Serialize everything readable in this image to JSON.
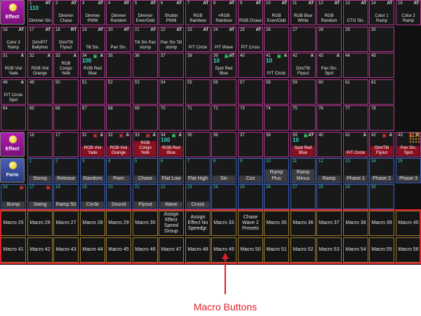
{
  "rows": [
    {
      "head": {
        "kind": "effect",
        "label": "Effect"
      },
      "cells": [
        {
          "num": "1",
          "tag": "AT",
          "big": "110",
          "label": "Dimmer Sin",
          "style": "blue"
        },
        {
          "num": "2",
          "tag": "AT",
          "label": "Dimmer Chase"
        },
        {
          "num": "3",
          "tag": "AT",
          "label": "Dimmer PWM"
        },
        {
          "num": "4",
          "tag": "AT",
          "label": "Dimmer Random"
        },
        {
          "num": "5",
          "tag": "AT",
          "label": "Dimmer Even/Odd"
        },
        {
          "num": "6",
          "tag": "AT",
          "label": "Shutter PWM"
        },
        {
          "num": "7",
          "tag": "AT",
          "label": "RGB Rainbow"
        },
        {
          "num": "8",
          "tag": "AT",
          "label": "+RGB Rainbow"
        },
        {
          "num": "9",
          "tag": "AT",
          "label": "RGB Chase"
        },
        {
          "num": "10",
          "tag": "AT",
          "label": "RGB Even/Odd"
        },
        {
          "num": "11",
          "tag": "AT",
          "label": "RGB Blue White"
        },
        {
          "num": "12",
          "tag": "AT",
          "label": "RGB Random"
        },
        {
          "num": "13",
          "tag": "AT",
          "label": "CTO Sin."
        },
        {
          "num": "14",
          "tag": "AT",
          "label": "Color 1 Ramp"
        },
        {
          "num": "15",
          "tag": "AT",
          "label": "Color 2 Ramp"
        }
      ]
    },
    {
      "head": null,
      "cells": [
        {
          "num": "16",
          "tag": "AT",
          "label": "Color 3 Ramp"
        },
        {
          "num": "17",
          "tag": "AT",
          "label": "Dim/P/T Ballyhoo"
        },
        {
          "num": "18",
          "tag": "RT",
          "label": "Dim/Tilt Flyout"
        },
        {
          "num": "19",
          "tag": "AT",
          "label": "Tilt Sin."
        },
        {
          "num": "20",
          "tag": "AT",
          "label": "Pan Sin."
        },
        {
          "num": "21",
          "tag": "AT",
          "label": "Tilt Sin Pan stomp"
        },
        {
          "num": "22",
          "tag": "AT",
          "label": "Pan Sin Tilt stomp"
        },
        {
          "num": "23",
          "tag": "AT",
          "label": "P/T Circle"
        },
        {
          "num": "24",
          "tag": "AT",
          "label": "P/T Wave"
        },
        {
          "num": "25",
          "tag": "AT",
          "label": "P/T Cross"
        },
        {
          "num": "26",
          "label": ""
        },
        {
          "num": "27",
          "label": ""
        },
        {
          "num": "28",
          "label": ""
        },
        {
          "num": "29",
          "label": ""
        },
        {
          "num": "30",
          "label": ""
        }
      ]
    },
    {
      "head": null,
      "cells": [
        {
          "num": "31",
          "tag": "A",
          "label": "RGB Viol Yade"
        },
        {
          "num": "32",
          "tag": "A",
          "label": "RGB Viol Orange"
        },
        {
          "num": "33",
          "tag": "A",
          "label": "RGB Congo Yello"
        },
        {
          "num": "34",
          "tag": "A",
          "green": true,
          "big": "100",
          "label": "RGB Red Blue"
        },
        {
          "num": "35",
          "label": ""
        },
        {
          "num": "36",
          "label": ""
        },
        {
          "num": "37",
          "label": ""
        },
        {
          "num": "38",
          "label": ""
        },
        {
          "num": "39",
          "green": true,
          "big": "10",
          "tag": "AT",
          "label": "Spot Red Blue"
        },
        {
          "num": "40",
          "label": ""
        },
        {
          "num": "41",
          "green": true,
          "big": "10",
          "tag": "A",
          "label": "P/T Circle"
        },
        {
          "num": "42",
          "tag": "A",
          "label": "Dim/Tilt Flyout"
        },
        {
          "num": "43",
          "tag": "A",
          "label": "Pan Sin. Spot"
        },
        {
          "num": "44",
          "label": ""
        },
        {
          "num": "45",
          "label": ""
        }
      ]
    },
    {
      "head": null,
      "cells": [
        {
          "num": "46",
          "tag": "A",
          "label": "P/T Circle Spot"
        },
        {
          "num": "49",
          "label": ""
        },
        {
          "num": "50",
          "label": ""
        },
        {
          "num": "51",
          "label": ""
        },
        {
          "num": "52",
          "label": ""
        },
        {
          "num": "53",
          "label": ""
        },
        {
          "num": "54",
          "label": ""
        },
        {
          "num": "55",
          "label": ""
        },
        {
          "num": "56",
          "label": ""
        },
        {
          "num": "57",
          "label": ""
        },
        {
          "num": "58",
          "label": ""
        },
        {
          "num": "59",
          "label": ""
        },
        {
          "num": "60",
          "label": ""
        },
        {
          "num": "61",
          "label": ""
        },
        {
          "num": "62",
          "label": ""
        }
      ]
    },
    {
      "head": null,
      "cells": [
        {
          "num": "64",
          "label": ""
        },
        {
          "num": "65",
          "label": ""
        },
        {
          "num": "66",
          "label": ""
        },
        {
          "num": "67",
          "label": ""
        },
        {
          "num": "68",
          "label": ""
        },
        {
          "num": "69",
          "label": ""
        },
        {
          "num": "70",
          "label": ""
        },
        {
          "num": "71",
          "label": ""
        },
        {
          "num": "72",
          "label": ""
        },
        {
          "num": "73",
          "label": ""
        },
        {
          "num": "74",
          "label": ""
        },
        {
          "num": "75",
          "label": ""
        },
        {
          "num": "76",
          "label": ""
        },
        {
          "num": "77",
          "label": ""
        },
        {
          "num": "78",
          "label": ""
        }
      ]
    },
    {
      "head": {
        "kind": "effect",
        "label": "Effect"
      },
      "cells": [
        {
          "num": "16",
          "label": ""
        },
        {
          "num": "17",
          "label": ""
        },
        {
          "num": "31",
          "tag": "A",
          "lock": true,
          "label": "RGB Viol Yade",
          "red": true
        },
        {
          "num": "32",
          "tag": "A",
          "lock": true,
          "label": "RGB Viol Orange",
          "red": true
        },
        {
          "num": "33",
          "tag": "A",
          "lock": true,
          "label": "RGB Congo Yello",
          "red": true
        },
        {
          "num": "34",
          "tag": "A",
          "green": true,
          "big": "100",
          "label": "RGB Red Blue",
          "red": true
        },
        {
          "num": "35",
          "label": ""
        },
        {
          "num": "36",
          "label": ""
        },
        {
          "num": "37",
          "label": ""
        },
        {
          "num": "38",
          "label": ""
        },
        {
          "num": "39",
          "green": true,
          "big": "10",
          "tag": "AT",
          "label": "Spot Red Blue",
          "red": true
        },
        {
          "num": "40",
          "label": ""
        },
        {
          "num": "41",
          "tag": "A",
          "label": "P/T Circle",
          "red": true
        },
        {
          "num": "42",
          "tag": "A",
          "lock": true,
          "label": "Dim/Tilt Flyout",
          "red": true
        },
        {
          "num": "43",
          "tag": "A",
          "lock": true,
          "label": "Pan Sin. Spot",
          "red": true
        }
      ]
    },
    {
      "head": {
        "kind": "form",
        "label": "Form"
      },
      "cells": [
        {
          "num": "1",
          "label": "Stomp",
          "sel": true
        },
        {
          "num": "2",
          "label": "Release",
          "sel": true
        },
        {
          "num": "3",
          "label": "Random",
          "sel": true
        },
        {
          "num": "4",
          "label": "Pwm",
          "sel": true
        },
        {
          "num": "5",
          "label": "Chase",
          "sel": true
        },
        {
          "num": "6",
          "label": "Flat Low",
          "sel": true
        },
        {
          "num": "7",
          "label": "Flat High",
          "sel": true
        },
        {
          "num": "8",
          "label": "Sin",
          "sel": true
        },
        {
          "num": "9",
          "label": "Cos",
          "sel": true
        },
        {
          "num": "10",
          "label": "Ramp Plus",
          "sel": true
        },
        {
          "num": "11",
          "label": "Ramp Minus",
          "sel": true
        },
        {
          "num": "12",
          "label": "Ramp",
          "sel": true
        },
        {
          "num": "13",
          "label": "Phase 1",
          "sel": true
        },
        {
          "num": "14",
          "label": "Phase 2",
          "sel": true
        },
        {
          "num": "15",
          "label": "Phase 3",
          "sel": true
        }
      ]
    },
    {
      "head": null,
      "cells": [
        {
          "num": "16",
          "lock": true,
          "label": "Bump",
          "sel": true
        },
        {
          "num": "17",
          "lock": true,
          "label": "Swing",
          "sel": true
        },
        {
          "num": "18",
          "label": "Ramp 50",
          "sel": true
        },
        {
          "num": "19",
          "label": "Circle",
          "sel": true
        },
        {
          "num": "20",
          "label": "Sound",
          "sel": true
        },
        {
          "num": "21",
          "label": "Flyout",
          "sel": true
        },
        {
          "num": "22",
          "label": "Wave",
          "sel": true
        },
        {
          "num": "23",
          "label": "Cross",
          "sel": true
        },
        {
          "num": "24",
          "label": ""
        },
        {
          "num": "25",
          "label": ""
        },
        {
          "num": "26",
          "label": ""
        },
        {
          "num": "27",
          "label": ""
        },
        {
          "num": "28",
          "label": ""
        },
        {
          "num": "29",
          "label": ""
        },
        {
          "num": "30",
          "label": ""
        }
      ]
    },
    {
      "head": null,
      "macro": true,
      "cells": [
        {
          "label": "Macro 25"
        },
        {
          "label": "Macro 26"
        },
        {
          "label": "Macro 27"
        },
        {
          "label": "Macro 28"
        },
        {
          "label": "Macro 29"
        },
        {
          "label": "Macro 30"
        },
        {
          "label": "Assign Effect Speed Group"
        },
        {
          "label": "Assign Effect No Speedgr."
        },
        {
          "label": "Macro 33"
        },
        {
          "label": "Chase Wave 2 Presets"
        },
        {
          "label": "Macro 35"
        },
        {
          "label": "Macro 36"
        },
        {
          "label": "Macro 37"
        },
        {
          "label": "Macro 38"
        },
        {
          "label": "Macro 39"
        },
        {
          "label": "Macro 40"
        }
      ]
    },
    {
      "head": null,
      "macro": true,
      "cells": [
        {
          "label": "Macro 41"
        },
        {
          "label": "Macro 42"
        },
        {
          "label": "Macro 43"
        },
        {
          "label": "Macro 44"
        },
        {
          "label": "Macro 45"
        },
        {
          "label": "Macro 46"
        },
        {
          "label": "Macro 47"
        },
        {
          "label": "Macro 48"
        },
        {
          "label": "Macro 49"
        },
        {
          "label": "Macro 50"
        },
        {
          "label": "Macro 51"
        },
        {
          "label": "Macro 52"
        },
        {
          "label": "Macro 53"
        },
        {
          "label": "Macro 54"
        },
        {
          "label": "Macro 55"
        },
        {
          "label": "Macro 56"
        }
      ]
    }
  ],
  "callout": {
    "label": "Macro Buttons"
  },
  "colors": {
    "accent": "#e0202a",
    "effect_head": "#b01eb0",
    "form_head": "#3f57b0",
    "cyan_text": "#3fd7d0"
  }
}
